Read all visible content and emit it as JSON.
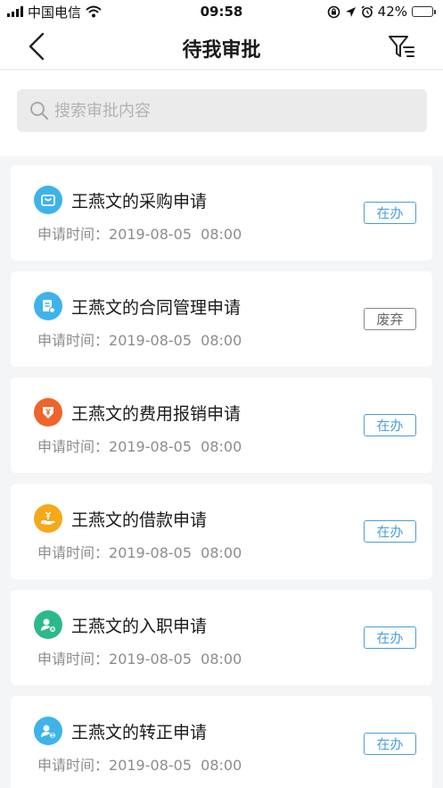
{
  "status_bar": {
    "carrier": "中国电信",
    "time": "09:58",
    "battery_percent": "42%",
    "battery_level": 0.42
  },
  "nav": {
    "title": "待我审批",
    "back_icon": "chevron-left-icon",
    "filter_icon": "filter-icon"
  },
  "search": {
    "placeholder": "搜索审批内容",
    "value": ""
  },
  "colors": {
    "badge_active": "#4a9fd8",
    "badge_void": "#888888"
  },
  "time_label": "申请时间：",
  "items": [
    {
      "title": "王燕文的采购申请",
      "time": "2019-08-05  08:00",
      "status": "在办",
      "icon": "shopping-bag-icon",
      "icon_color": "#3eb3ea"
    },
    {
      "title": "王燕文的合同管理申请",
      "time": "2019-08-05  08:00",
      "status": "废弃",
      "icon": "contract-icon",
      "icon_color": "#3eb3ea"
    },
    {
      "title": "王燕文的费用报销申请",
      "time": "2019-08-05  08:00",
      "status": "在办",
      "icon": "expense-icon",
      "icon_color": "#f0642c"
    },
    {
      "title": "王燕文的借款申请",
      "time": "2019-08-05  08:00",
      "status": "在办",
      "icon": "loan-icon",
      "icon_color": "#f6a81a"
    },
    {
      "title": "王燕文的入职申请",
      "time": "2019-08-05  08:00",
      "status": "在办",
      "icon": "onboarding-icon",
      "icon_color": "#2cb98a"
    },
    {
      "title": "王燕文的转正申请",
      "time": "2019-08-05  08:00",
      "status": "在办",
      "icon": "regularization-icon",
      "icon_color": "#3eb3ea"
    }
  ]
}
